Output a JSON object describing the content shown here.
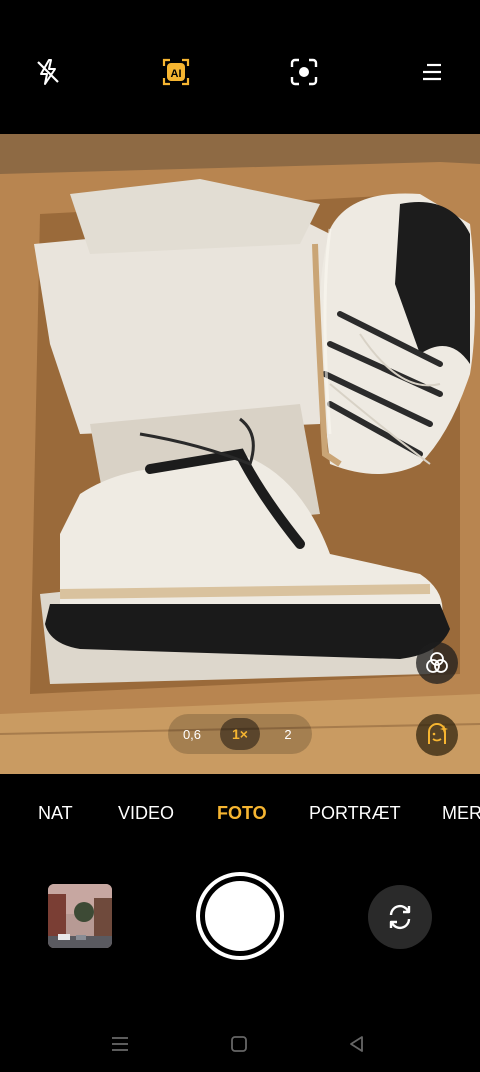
{
  "toolbar": {
    "flash_icon": "flash-off-icon",
    "ai_label": "AI",
    "ai_color": "#f6b531",
    "lens_icon": "google-lens-icon",
    "menu_icon": "menu-icon"
  },
  "zoom": {
    "options": [
      "0,6",
      "1×",
      "2"
    ],
    "selected": "1×"
  },
  "modes": {
    "items": [
      "NAT",
      "VIDEO",
      "FOTO",
      "PORTRÆT",
      "MER"
    ],
    "selected": "FOTO",
    "accent": "#f6b531"
  },
  "controls": {
    "filter_icon": "filter-icon",
    "beauty_icon": "beauty-icon",
    "gallery_icon": "gallery-thumbnail",
    "shutter_icon": "shutter-button",
    "switch_icon": "switch-camera-icon"
  },
  "navigation": {
    "menu": "recent-apps-icon",
    "home": "home-icon",
    "back": "back-icon"
  }
}
